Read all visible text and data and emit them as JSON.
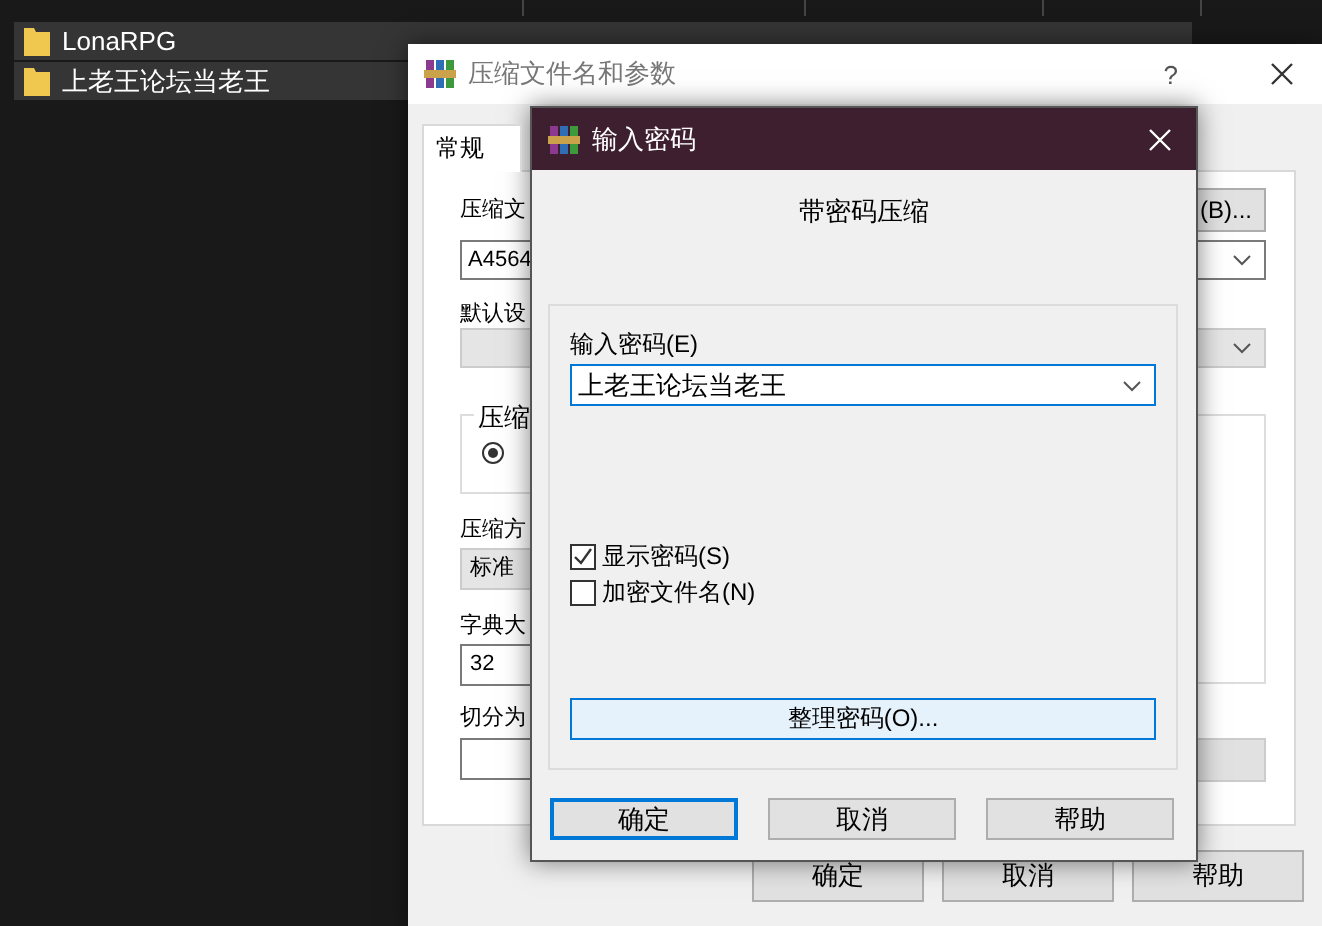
{
  "explorer": {
    "rows": [
      {
        "name": "LonaRPG",
        "selected": true
      },
      {
        "name": "上老王论坛当老王",
        "selected": true
      }
    ]
  },
  "archive_dialog": {
    "title": "压缩文件名和参数",
    "help": "?",
    "tabs": [
      {
        "label": "常规",
        "selected": true
      }
    ],
    "archive_name_label": "压缩文",
    "browse_button": "(B)...",
    "archive_name_value": "A4564",
    "profile_label": "默认设",
    "group_label": "压缩",
    "radio": {
      "selected": true
    },
    "method_label": "压缩方",
    "method_value": "标准",
    "dictionary_label": "字典大",
    "dictionary_value": "32",
    "split_label": "切分为",
    "buttons": [
      "确定",
      "取消",
      "帮助"
    ]
  },
  "password_dialog": {
    "title": "输入密码",
    "heading": "带密码压缩",
    "password_label": "输入密码(E)",
    "password_value": "上老王论坛当老王",
    "options": [
      {
        "label": "显示密码(S)",
        "checked": true
      },
      {
        "label": "加密文件名(N)",
        "checked": false
      }
    ],
    "organize_button": "整理密码(O)...",
    "buttons": [
      {
        "label": "确定",
        "default": true
      },
      {
        "label": "取消",
        "default": false
      },
      {
        "label": "帮助",
        "default": false
      }
    ]
  }
}
